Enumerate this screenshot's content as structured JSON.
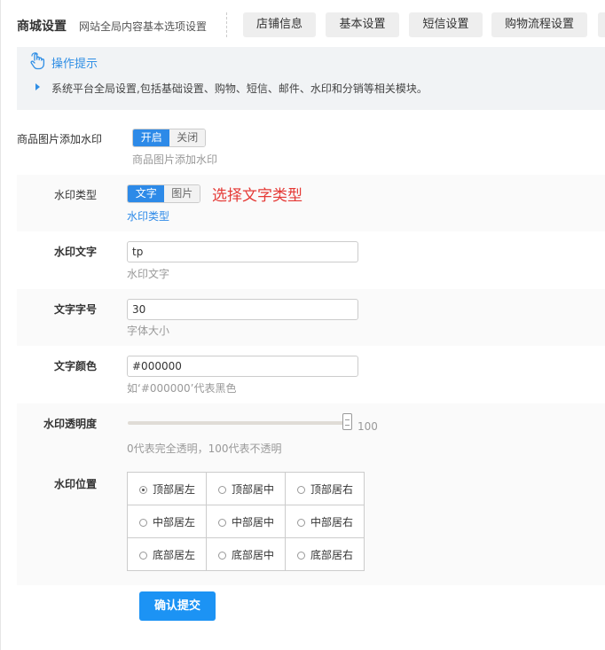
{
  "header": {
    "title": "商城设置",
    "subtitle": "网站全局内容基本选项设置",
    "tabs": [
      {
        "label": "店铺信息"
      },
      {
        "label": "基本设置"
      },
      {
        "label": "短信设置"
      },
      {
        "label": "购物流程设置"
      }
    ]
  },
  "tips": {
    "title": "操作提示",
    "items": [
      "系统平台全局设置,包括基础设置、购物、短信、邮件、水印和分销等相关模块。"
    ]
  },
  "form": {
    "watermark_enable": {
      "label": "商品图片添加水印",
      "on_label": "开启",
      "off_label": "关闭",
      "hint": "商品图片添加水印",
      "selected": "开启"
    },
    "watermark_type": {
      "label": "水印类型",
      "options": [
        "文字",
        "图片"
      ],
      "selected": "文字",
      "annotation": "选择文字类型",
      "hint": "水印类型"
    },
    "watermark_text": {
      "label": "水印文字",
      "value": "tp",
      "hint": "水印文字"
    },
    "font_size": {
      "label": "文字字号",
      "value": "30",
      "hint": "字体大小"
    },
    "font_color": {
      "label": "文字颜色",
      "value": "#000000",
      "hint": "如‘#000000’代表黑色"
    },
    "opacity": {
      "label": "水印透明度",
      "value": "100",
      "level": 1.0,
      "hint": "0代表完全透明，100代表不透明"
    },
    "position": {
      "label": "水印位置",
      "options": [
        [
          "顶部居左",
          "顶部居中",
          "顶部居右"
        ],
        [
          "中部居左",
          "中部居中",
          "中部居右"
        ],
        [
          "底部居左",
          "底部居中",
          "底部居右"
        ]
      ],
      "selected": "顶部居左"
    },
    "submit_label": "确认提交"
  },
  "colors": {
    "accent": "#2d8ae8",
    "submit": "#1c93f4",
    "annotation": "#e53935"
  },
  "icons": {
    "tips": "hand-pointer-icon",
    "bullet": "triangle-right-icon"
  }
}
